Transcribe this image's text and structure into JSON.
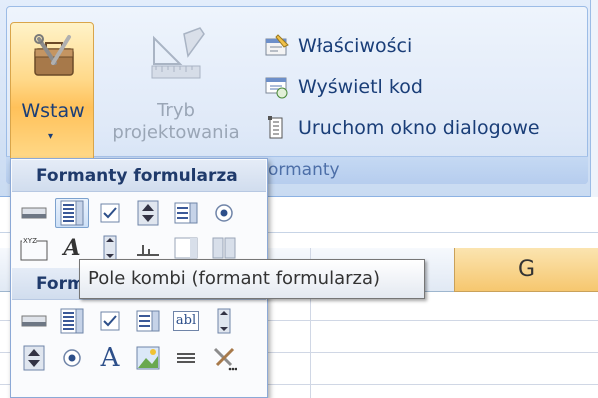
{
  "ribbon": {
    "wstaw_label": "Wstaw",
    "wstaw_arrow": "▾",
    "tryb_label": "Tryb projektowania",
    "commands": [
      {
        "label": "Właściwości",
        "icon": "properties-icon"
      },
      {
        "label": "Wyświetl kod",
        "icon": "view-code-icon"
      },
      {
        "label": "Uruchom okno dialogowe",
        "icon": "run-dialog-icon"
      }
    ],
    "group_label": "ormanty"
  },
  "sheet": {
    "column_g": "G"
  },
  "dropdown": {
    "form_controls_header": "Formanty formularza",
    "activex_header": "Formanty ActiveX",
    "form_controls_row1": [
      "button-icon",
      "combo-box-icon",
      "checkbox-icon",
      "spin-button-icon",
      "list-box-icon",
      "option-button-icon"
    ],
    "form_controls_row2": [
      "group-box-icon",
      "label-icon",
      "scroll-bar-icon",
      "toggle-icon",
      "combo-edit-icon",
      "dropdown-list-icon"
    ],
    "activex_row1": [
      "command-button-icon",
      "combo-box-icon",
      "checkbox-icon",
      "list-box-icon",
      "text-box-icon",
      "scroll-bar-icon"
    ],
    "activex_row2": [
      "spin-button-icon",
      "option-button-icon",
      "label-icon",
      "image-icon",
      "toggle-button-icon",
      "more-controls-icon"
    ],
    "label_glyph": "A",
    "text_box_glyph": "abl"
  },
  "tooltip": {
    "text": "Pole kombi (formant formularza)"
  },
  "colors": {
    "highlight": "#ffc15a",
    "ribbon_text": "#1a3e78",
    "header_g": "#f6c76f"
  }
}
